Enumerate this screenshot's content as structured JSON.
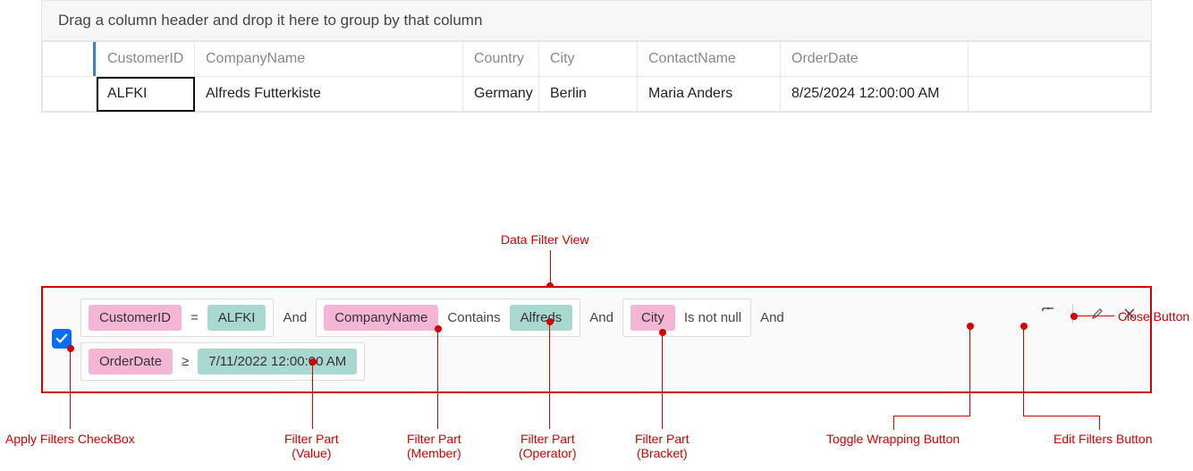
{
  "group_panel_text": "Drag a column header and drop it here to group by that column",
  "columns": [
    "CustomerID",
    "CompanyName",
    "Country",
    "City",
    "ContactName",
    "OrderDate"
  ],
  "row": {
    "CustomerID": "ALFKI",
    "CompanyName": "Alfreds Futterkiste",
    "Country": "Germany",
    "City": "Berlin",
    "ContactName": "Maria Anders",
    "OrderDate": "8/25/2024 12:00:00 AM"
  },
  "filter": {
    "checked": true,
    "groups": [
      {
        "member": "CustomerID",
        "operator": "=",
        "value": "ALFKI"
      },
      {
        "member": "CompanyName",
        "operator": "Contains",
        "value": "Alfreds"
      },
      {
        "member": "City",
        "operator": "Is not null"
      },
      {
        "member": "OrderDate",
        "operator": "≥",
        "value": "7/11/2022 12:00:00 AM"
      }
    ],
    "logic": "And"
  },
  "annotations": {
    "data_filter_view": "Data Filter View",
    "close_button": "Close Button",
    "apply_checkbox": "Apply Filters CheckBox",
    "filter_part_value": "Filter Part\n(Value)",
    "filter_part_member": "Filter Part\n(Member)",
    "filter_part_operator": "Filter Part\n(Operator)",
    "filter_part_bracket": "Filter Part\n(Bracket)",
    "toggle_wrapping": "Toggle Wrapping Button",
    "edit_filters": "Edit Filters Button"
  }
}
